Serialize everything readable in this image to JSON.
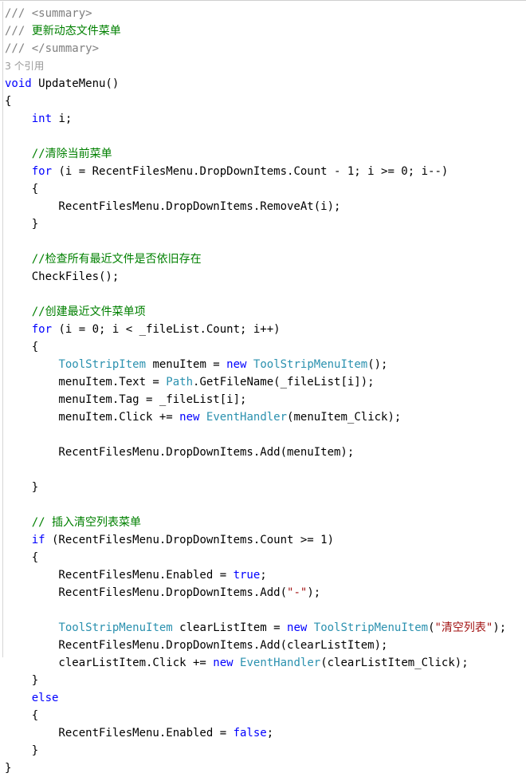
{
  "editor": {
    "language": "csharp",
    "background_color": "#ffffff",
    "font_size_px": 14,
    "line_height_px": 22,
    "colors": {
      "plain": "#000000",
      "keyword": "#0000ff",
      "comment": "#008000",
      "doc_comment": "#808080",
      "type": "#2b91af",
      "string": "#a31515",
      "codelens": "#9a9a9a",
      "border": "#cfcfcf"
    }
  },
  "codelens": {
    "text": "3 个引用"
  },
  "lines": [
    {
      "id": 1,
      "tokens": [
        {
          "k": "doc",
          "t": "/// <summary>"
        }
      ]
    },
    {
      "id": 2,
      "tokens": [
        {
          "k": "doc",
          "t": "/// "
        },
        {
          "k": "comment",
          "t": "更新动态文件菜单"
        }
      ]
    },
    {
      "id": 3,
      "tokens": [
        {
          "k": "doc",
          "t": "/// </summary>"
        }
      ]
    },
    {
      "id": 4,
      "tokens": [
        {
          "k": "codelens",
          "t": "3 个引用"
        }
      ]
    },
    {
      "id": 5,
      "tokens": [
        {
          "k": "keyword",
          "t": "void"
        },
        {
          "k": "plain",
          "t": " UpdateMenu()"
        }
      ]
    },
    {
      "id": 6,
      "tokens": [
        {
          "k": "plain",
          "t": "{"
        }
      ]
    },
    {
      "id": 7,
      "tokens": [
        {
          "k": "keyword",
          "t": "    int"
        },
        {
          "k": "plain",
          "t": " i;"
        }
      ]
    },
    {
      "id": 8,
      "tokens": [
        {
          "k": "plain",
          "t": ""
        }
      ]
    },
    {
      "id": 9,
      "tokens": [
        {
          "k": "comment",
          "t": "    //清除当前菜单"
        }
      ]
    },
    {
      "id": 10,
      "tokens": [
        {
          "k": "keyword",
          "t": "    for"
        },
        {
          "k": "plain",
          "t": " (i = RecentFilesMenu.DropDownItems.Count - 1; i >= 0; i--)"
        }
      ]
    },
    {
      "id": 11,
      "tokens": [
        {
          "k": "plain",
          "t": "    {"
        }
      ]
    },
    {
      "id": 12,
      "tokens": [
        {
          "k": "plain",
          "t": "        RecentFilesMenu.DropDownItems.RemoveAt(i);"
        }
      ]
    },
    {
      "id": 13,
      "tokens": [
        {
          "k": "plain",
          "t": "    }"
        }
      ]
    },
    {
      "id": 14,
      "tokens": [
        {
          "k": "plain",
          "t": ""
        }
      ]
    },
    {
      "id": 15,
      "tokens": [
        {
          "k": "comment",
          "t": "    //检查所有最近文件是否依旧存在"
        }
      ]
    },
    {
      "id": 16,
      "tokens": [
        {
          "k": "plain",
          "t": "    CheckFiles();"
        }
      ]
    },
    {
      "id": 17,
      "tokens": [
        {
          "k": "plain",
          "t": ""
        }
      ]
    },
    {
      "id": 18,
      "tokens": [
        {
          "k": "comment",
          "t": "    //创建最近文件菜单项"
        }
      ]
    },
    {
      "id": 19,
      "tokens": [
        {
          "k": "keyword",
          "t": "    for"
        },
        {
          "k": "plain",
          "t": " (i = 0; i < _fileList.Count; i++)"
        }
      ]
    },
    {
      "id": 20,
      "tokens": [
        {
          "k": "plain",
          "t": "    {"
        }
      ]
    },
    {
      "id": 21,
      "tokens": [
        {
          "k": "plain",
          "t": "        "
        },
        {
          "k": "type",
          "t": "ToolStripItem"
        },
        {
          "k": "plain",
          "t": " menuItem = "
        },
        {
          "k": "keyword",
          "t": "new"
        },
        {
          "k": "plain",
          "t": " "
        },
        {
          "k": "type",
          "t": "ToolStripMenuItem"
        },
        {
          "k": "plain",
          "t": "();"
        }
      ]
    },
    {
      "id": 22,
      "tokens": [
        {
          "k": "plain",
          "t": "        menuItem.Text = "
        },
        {
          "k": "type",
          "t": "Path"
        },
        {
          "k": "plain",
          "t": ".GetFileName(_fileList[i]);"
        }
      ]
    },
    {
      "id": 23,
      "tokens": [
        {
          "k": "plain",
          "t": "        menuItem.Tag = _fileList[i];"
        }
      ]
    },
    {
      "id": 24,
      "tokens": [
        {
          "k": "plain",
          "t": "        menuItem.Click += "
        },
        {
          "k": "keyword",
          "t": "new"
        },
        {
          "k": "plain",
          "t": " "
        },
        {
          "k": "type",
          "t": "EventHandler"
        },
        {
          "k": "plain",
          "t": "(menuItem_Click);"
        }
      ]
    },
    {
      "id": 25,
      "tokens": [
        {
          "k": "plain",
          "t": ""
        }
      ]
    },
    {
      "id": 26,
      "tokens": [
        {
          "k": "plain",
          "t": "        RecentFilesMenu.DropDownItems.Add(menuItem);"
        }
      ]
    },
    {
      "id": 27,
      "tokens": [
        {
          "k": "plain",
          "t": ""
        }
      ]
    },
    {
      "id": 28,
      "tokens": [
        {
          "k": "plain",
          "t": "    }"
        }
      ]
    },
    {
      "id": 29,
      "tokens": [
        {
          "k": "plain",
          "t": ""
        }
      ]
    },
    {
      "id": 30,
      "tokens": [
        {
          "k": "comment",
          "t": "    // 插入清空列表菜单"
        }
      ]
    },
    {
      "id": 31,
      "tokens": [
        {
          "k": "keyword",
          "t": "    if"
        },
        {
          "k": "plain",
          "t": " (RecentFilesMenu.DropDownItems.Count >= 1)"
        }
      ]
    },
    {
      "id": 32,
      "tokens": [
        {
          "k": "plain",
          "t": "    {"
        }
      ]
    },
    {
      "id": 33,
      "tokens": [
        {
          "k": "plain",
          "t": "        RecentFilesMenu.Enabled = "
        },
        {
          "k": "keyword",
          "t": "true"
        },
        {
          "k": "plain",
          "t": ";"
        }
      ]
    },
    {
      "id": 34,
      "tokens": [
        {
          "k": "plain",
          "t": "        RecentFilesMenu.DropDownItems.Add("
        },
        {
          "k": "string",
          "t": "\"-\""
        },
        {
          "k": "plain",
          "t": ");"
        }
      ]
    },
    {
      "id": 35,
      "tokens": [
        {
          "k": "plain",
          "t": ""
        }
      ]
    },
    {
      "id": 36,
      "tokens": [
        {
          "k": "plain",
          "t": "        "
        },
        {
          "k": "type",
          "t": "ToolStripMenuItem"
        },
        {
          "k": "plain",
          "t": " clearListItem = "
        },
        {
          "k": "keyword",
          "t": "new"
        },
        {
          "k": "plain",
          "t": " "
        },
        {
          "k": "type",
          "t": "ToolStripMenuItem"
        },
        {
          "k": "plain",
          "t": "("
        },
        {
          "k": "string",
          "t": "\"清空列表\""
        },
        {
          "k": "plain",
          "t": ");"
        }
      ]
    },
    {
      "id": 37,
      "tokens": [
        {
          "k": "plain",
          "t": "        RecentFilesMenu.DropDownItems.Add(clearListItem);"
        }
      ]
    },
    {
      "id": 38,
      "tokens": [
        {
          "k": "plain",
          "t": "        clearListItem.Click += "
        },
        {
          "k": "keyword",
          "t": "new"
        },
        {
          "k": "plain",
          "t": " "
        },
        {
          "k": "type",
          "t": "EventHandler"
        },
        {
          "k": "plain",
          "t": "(clearListItem_Click);"
        }
      ]
    },
    {
      "id": 39,
      "tokens": [
        {
          "k": "plain",
          "t": "    }"
        }
      ]
    },
    {
      "id": 40,
      "tokens": [
        {
          "k": "keyword",
          "t": "    else"
        }
      ]
    },
    {
      "id": 41,
      "tokens": [
        {
          "k": "plain",
          "t": "    {"
        }
      ]
    },
    {
      "id": 42,
      "tokens": [
        {
          "k": "plain",
          "t": "        RecentFilesMenu.Enabled = "
        },
        {
          "k": "keyword",
          "t": "false"
        },
        {
          "k": "plain",
          "t": ";"
        }
      ]
    },
    {
      "id": 43,
      "tokens": [
        {
          "k": "plain",
          "t": "    }"
        }
      ]
    },
    {
      "id": 44,
      "tokens": [
        {
          "k": "plain",
          "t": "}"
        }
      ]
    }
  ]
}
